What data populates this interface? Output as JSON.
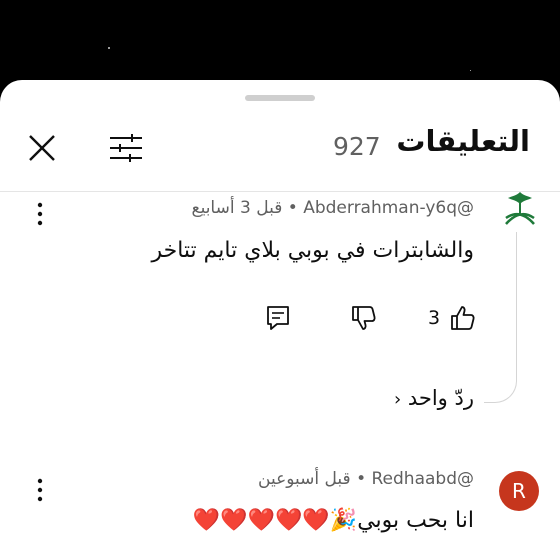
{
  "header": {
    "title": "التعليقات",
    "count": "927"
  },
  "comments": [
    {
      "author": "@Abderrahman-y6q",
      "time": "قبل 3 أسابيع",
      "text": "والشابترات في بوبي بلاي تايم تتاخر",
      "likes": "3",
      "replies_label": "ردّ واحد",
      "avatar_icon": "saudi-emblem-icon"
    },
    {
      "author": "@Redhaabd",
      "time": "قبل أسبوعين",
      "text": "انا بحب بوبي",
      "emoji": "❤️❤️❤️❤️❤️🎉",
      "avatar_letter": "R",
      "avatar_color": "#c6361d"
    }
  ],
  "separator": "•"
}
